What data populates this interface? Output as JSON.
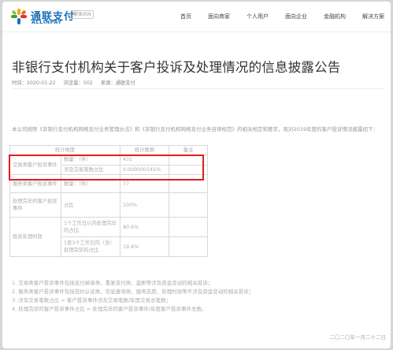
{
  "header": {
    "logo_cn": "通联支付",
    "logo_en": "ALLINPAY",
    "lang_label": "繁体/EN",
    "nav": [
      "首页",
      "面向商家",
      "个人用户",
      "面向企业",
      "金融机构",
      "解决方案"
    ]
  },
  "article": {
    "title": "非银行支付机构关于客户投诉及处理情况的信息披露公告",
    "time": "时间：2020-01-22",
    "views": "浏览量：502",
    "source": "来源：通联支付",
    "intro": "本公司按照《非银行支付机构网络支付业务管理办法》和《非银行支付机构网络支付业务自律规范》的相关规定和要求，现对2019年度的客户投诉情况披露如下：",
    "table": {
      "headers": [
        "统计维度",
        "统计数据",
        "备注"
      ],
      "rows": [
        {
          "cat": "交易类客户投诉事件",
          "dim": "数量：（件）",
          "val": "431"
        },
        {
          "cat": "",
          "dim": "涉及交易笔数占比",
          "val": "0.000000145%"
        },
        {
          "cat": "服务类客户投诉事件",
          "dim": "数量：（件）",
          "val": "77"
        },
        {
          "cat": "处理完毕的客户投诉事件",
          "dim": "占比",
          "val": "100%"
        },
        {
          "cat": "投诉处理时效",
          "dim": "1个工作日以内处理完毕的占比",
          "val": "80.6%"
        },
        {
          "cat": "",
          "dim": "1至3个工作日内（含）处理完毕的占比",
          "val": "19.4%"
        }
      ]
    },
    "notes": [
      "1. 交易类客户投诉事件包括支付掉单类、重复支付类、盗刷等涉及资金变动的相关投诉；",
      "2. 服务类客户投诉事件包括签约认证类、信息查询类、服务态度、处理时效等不涉及资金变动的相关投诉；",
      "3. 涉及交易笔数占比 = 客户投诉事件涉及交易笔数/年度交易总笔数；",
      "4. 处理完毕的客户投诉事件占比 = 处理完毕的客户投诉事件/年度客户投诉事件总数。"
    ],
    "date": "二〇二〇年一月二十二日"
  }
}
